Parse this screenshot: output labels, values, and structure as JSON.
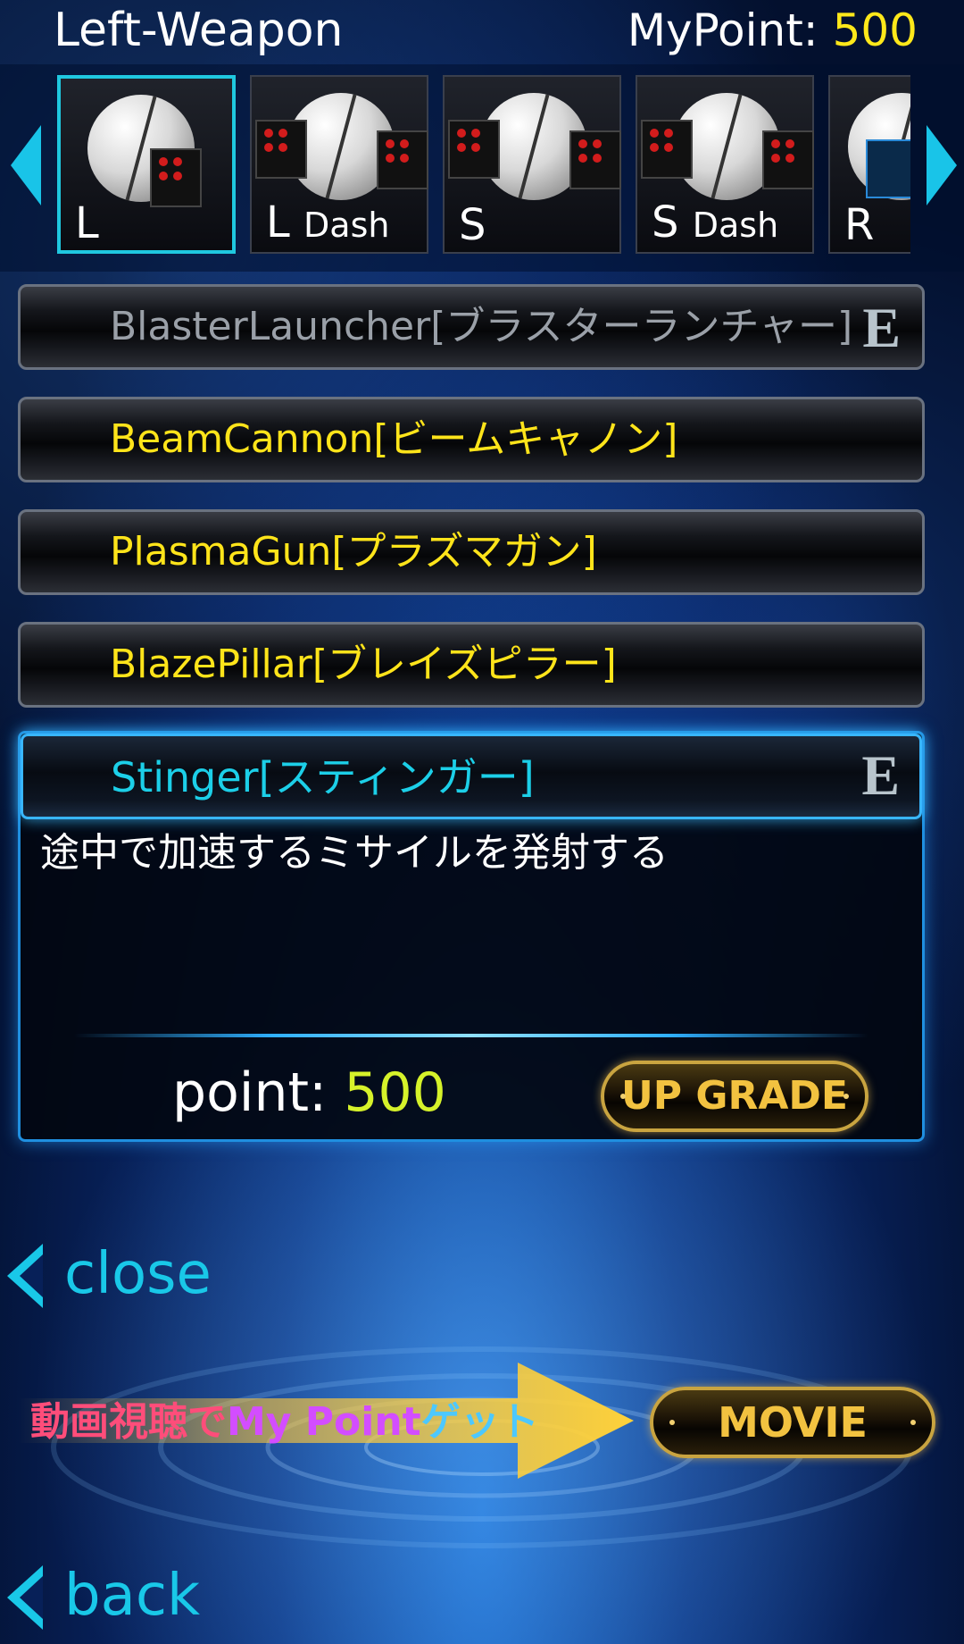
{
  "header": {
    "title": "Left-Weapon",
    "mypoint_label": "MyPoint:",
    "mypoint_value": "500"
  },
  "carousel": {
    "items": [
      {
        "label": "L",
        "sub": ""
      },
      {
        "label": "L",
        "sub": "Dash"
      },
      {
        "label": "S",
        "sub": ""
      },
      {
        "label": "S",
        "sub": "Dash"
      },
      {
        "label": "R",
        "sub": ""
      }
    ],
    "selected_index": 0,
    "accent": "#1fc8e0"
  },
  "weapons": [
    {
      "name": "BlasterLauncher[ブラスターランチャー]",
      "state": "disabled",
      "equipped": "E"
    },
    {
      "name": "BeamCannon[ビームキャノン]",
      "state": "normal",
      "equipped": ""
    },
    {
      "name": "PlasmaGun[プラズマガン]",
      "state": "normal",
      "equipped": ""
    },
    {
      "name": "BlazePillar[ブレイズピラー]",
      "state": "normal",
      "equipped": ""
    }
  ],
  "selected_weapon": {
    "name": "Stinger[スティンガー]",
    "equipped": "E",
    "description": "途中で加速するミサイルを発射する",
    "cost_label": "point:",
    "cost_value": "500",
    "upgrade_label": "UP GRADE"
  },
  "nav": {
    "close_label": "close",
    "back_label": "back"
  },
  "promo": {
    "text_part1": "動画視聴で",
    "text_part2": "My Point",
    "text_part3": "ゲット",
    "movie_label": "MOVIE"
  },
  "colors": {
    "gold_text": "#ffe41a",
    "cyan_text": "#1ccfe8",
    "point_value": "#d6f22a",
    "button_gold": "#f2c240"
  }
}
